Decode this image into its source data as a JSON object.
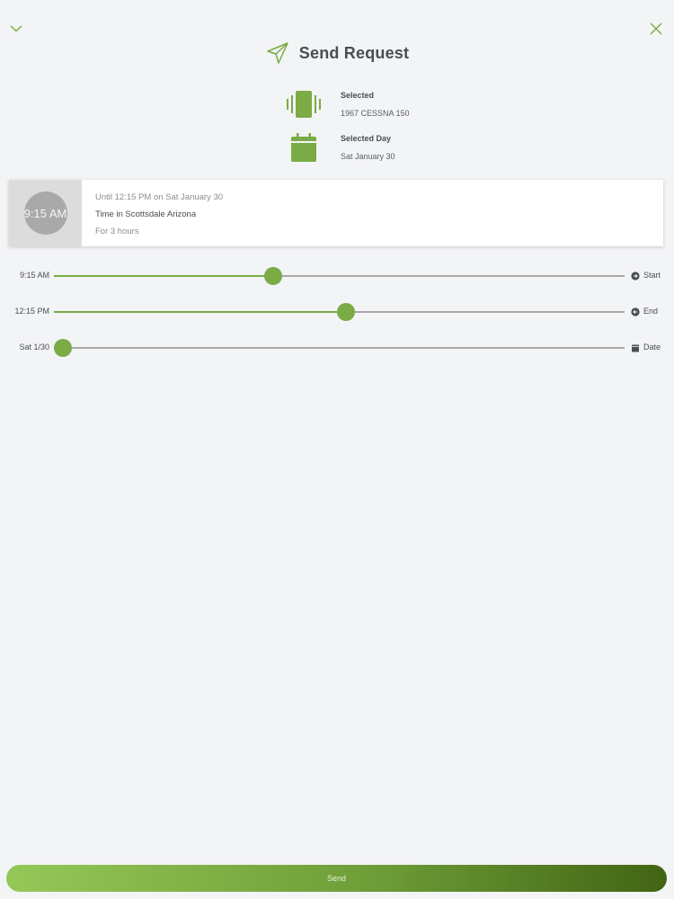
{
  "colors": {
    "accent": "#7aab45",
    "background": "#f3f4f6",
    "card": "#ffffff",
    "track": "#a8a8a8"
  },
  "icons": {
    "collapse": "chevron-down-icon",
    "close": "close-icon",
    "title": "send-icon",
    "aircraft": "aircraft-vibrate-icon",
    "day": "calendar-icon",
    "start": "arrow-circle-right-icon",
    "end": "arrow-circle-left-icon",
    "date": "calendar-icon"
  },
  "header": {
    "title": "Send Request"
  },
  "selection": {
    "aircraft": {
      "label": "Selected",
      "value": "1967 CESSNA 150"
    },
    "day": {
      "label": "Selected Day",
      "value": "Sat January 30"
    }
  },
  "summary": {
    "start_time": "9:15 AM",
    "until_text": "Until 12:15 PM on Sat January 30",
    "location_text": "Time in Scottsdale Arizona",
    "duration_text": "For  3 hours"
  },
  "sliders": [
    {
      "value": "9:15 AM",
      "label": "Start",
      "fraction": 0.385
    },
    {
      "value": "12:15 PM",
      "label": "End",
      "fraction": 0.512
    },
    {
      "value": "Sat 1/30",
      "label": "Date",
      "fraction": 0.016
    }
  ],
  "footer": {
    "send_label": "Send"
  }
}
